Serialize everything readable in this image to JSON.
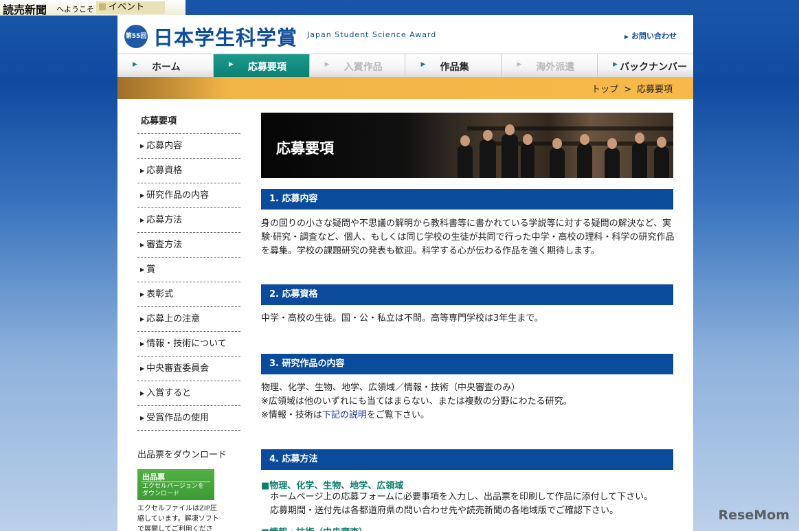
{
  "topbar": {
    "logo": "読売新聞",
    "welcome": "へようこそ",
    "event": "イベント"
  },
  "header": {
    "medal": "第55回",
    "title": "日本学生科学賞",
    "subtitle": "Japan Student Science Award",
    "contact": "お問い合わせ"
  },
  "nav": [
    {
      "label": "ホーム"
    },
    {
      "label": "応募要項"
    },
    {
      "label": "入賞作品"
    },
    {
      "label": "作品集"
    },
    {
      "label": "海外派遣"
    },
    {
      "label": "バックナンバー"
    }
  ],
  "breadcrumb": {
    "home": "トップ",
    "sep": ">",
    "current": "応募要項"
  },
  "sidebar": {
    "title": "応募要項",
    "items": [
      {
        "label": "応募内容"
      },
      {
        "label": "応募資格"
      },
      {
        "label": "研究作品の内容"
      },
      {
        "label": "応募方法"
      },
      {
        "label": "審査方法"
      },
      {
        "label": "賞"
      },
      {
        "label": "表彰式"
      },
      {
        "label": "応募上の注意"
      },
      {
        "label": "情報・技術について"
      },
      {
        "label": "中央審査委員会"
      },
      {
        "label": "入賞すると"
      },
      {
        "label": "受賞作品の使用"
      }
    ],
    "download_title": "出品票をダウンロード",
    "download_button": {
      "title": "出品票",
      "text": "エクセルバージョンを ダウンロード"
    },
    "download_note": "エクセルファイルはZIP圧縮しています。解凍ソフトで展開してご利用ください。"
  },
  "main": {
    "hero_title": "応募要項",
    "sections": [
      {
        "heading": "1. 応募内容",
        "text": "身の回りの小さな疑問や不思議の解明から教科書等に書かれている学説等に対する疑問の解決など、実験·研究・調査など、個人、もしくは同じ学校の生徒が共同で行った中学・高校の理科・科学の研究作品を募集。学校の課題研究の発表も歓迎。科学する心が伝わる作品を強く期待します。"
      },
      {
        "heading": "2. 応募資格",
        "text": "中学・高校の生徒。国・公・私立は不問。高等専門学校は3年生まで。"
      },
      {
        "heading": "3. 研究作品の内容",
        "line1": "物理、化学、生物、地学、広領域／情報・技術（中央審査のみ）",
        "line2": "※広領域は他のいずれにも当てはまらない、または複数の分野にわたる研究。",
        "line3_pre": "※情報・技術は",
        "line3_link": "下記の説明",
        "line3_post": "をご覧下さい。"
      },
      {
        "heading": "4. 応募方法",
        "subhead": "■物理、化学、生物、地学、広領域",
        "line1": "ホームページ上の応募フォームに必要事項を入力し、出品票を印刷して作品に添付して下さい。",
        "line2": "応募期間・送付先は各都道府県の問い合わせ先や読売新聞の各地域版でご確認下さい。",
        "subhead2": "■情報・技術（中央審査）"
      }
    ]
  },
  "watermark": "ReseMom",
  "colors": {
    "nav_active": "#0c7f74",
    "section_head": "#0a4b9b",
    "band": "#f8b94a",
    "download_btn": "#3e9a34"
  }
}
